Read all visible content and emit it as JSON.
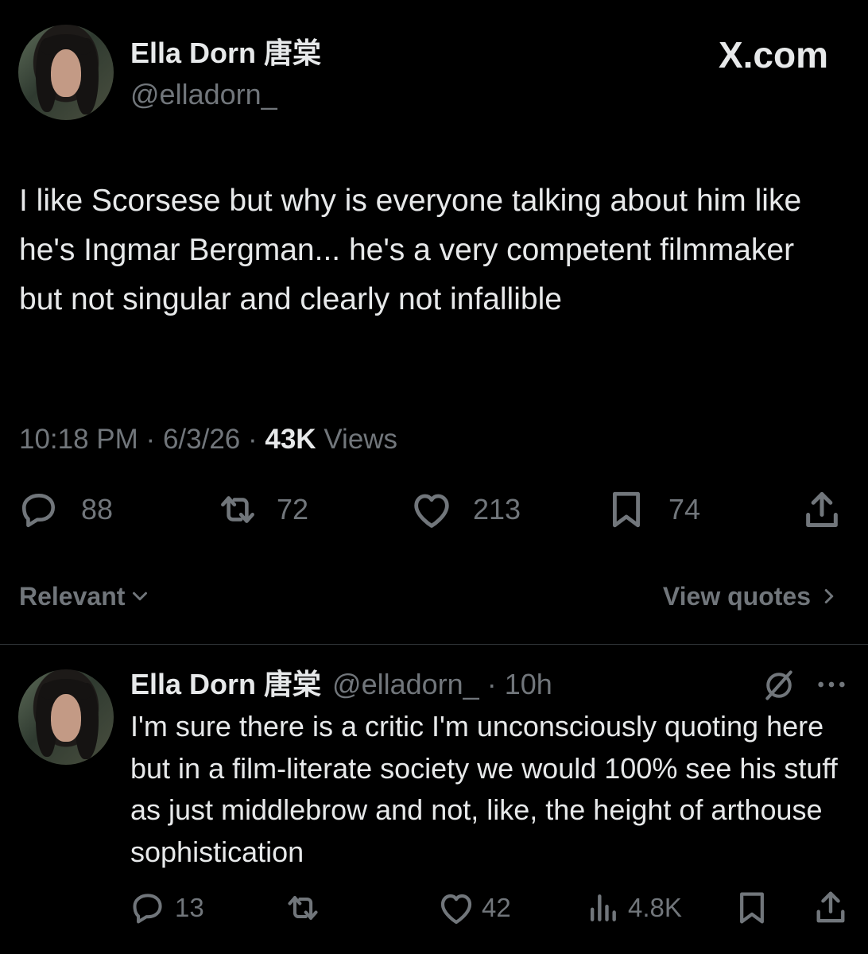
{
  "brand": {
    "label": "X.com"
  },
  "main_tweet": {
    "author_name": "Ella Dorn 唐棠",
    "author_handle": "@elladorn_",
    "text": "I like Scorsese but why is everyone talking about him like he's Ingmar Bergman... he's a very competent filmmaker but not singular and clearly not infallible",
    "time": "10:18 PM",
    "date": "6/3/26",
    "views_count": "43K",
    "views_label": "Views",
    "separator": "·",
    "replies": "88",
    "reposts": "72",
    "likes": "213",
    "bookmarks": "74"
  },
  "sort": {
    "label": "Relevant",
    "view_quotes": "View quotes"
  },
  "reply_tweet": {
    "author_name": "Ella Dorn 唐棠",
    "author_handle": "@elladorn_",
    "separator": "·",
    "time": "10h",
    "text": "I'm sure there is a critic I'm unconsciously quoting here but in a film-literate society we would 100% see his stuff as just middlebrow and not, like, the height of arthouse sophistication",
    "replies": "13",
    "likes": "42",
    "views": "4.8K"
  },
  "icons": {
    "reply": "reply-icon",
    "repost": "repost-icon",
    "like": "heart-icon",
    "bookmark": "bookmark-icon",
    "share": "share-icon",
    "views": "analytics-icon",
    "grok": "grok-icon",
    "more": "more-icon",
    "chevron_down": "chevron-down-icon",
    "chevron_right": "chevron-right-icon"
  },
  "colors": {
    "background": "#000000",
    "text": "#e7e9ea",
    "muted": "#71767b",
    "divider": "#2f3336"
  }
}
